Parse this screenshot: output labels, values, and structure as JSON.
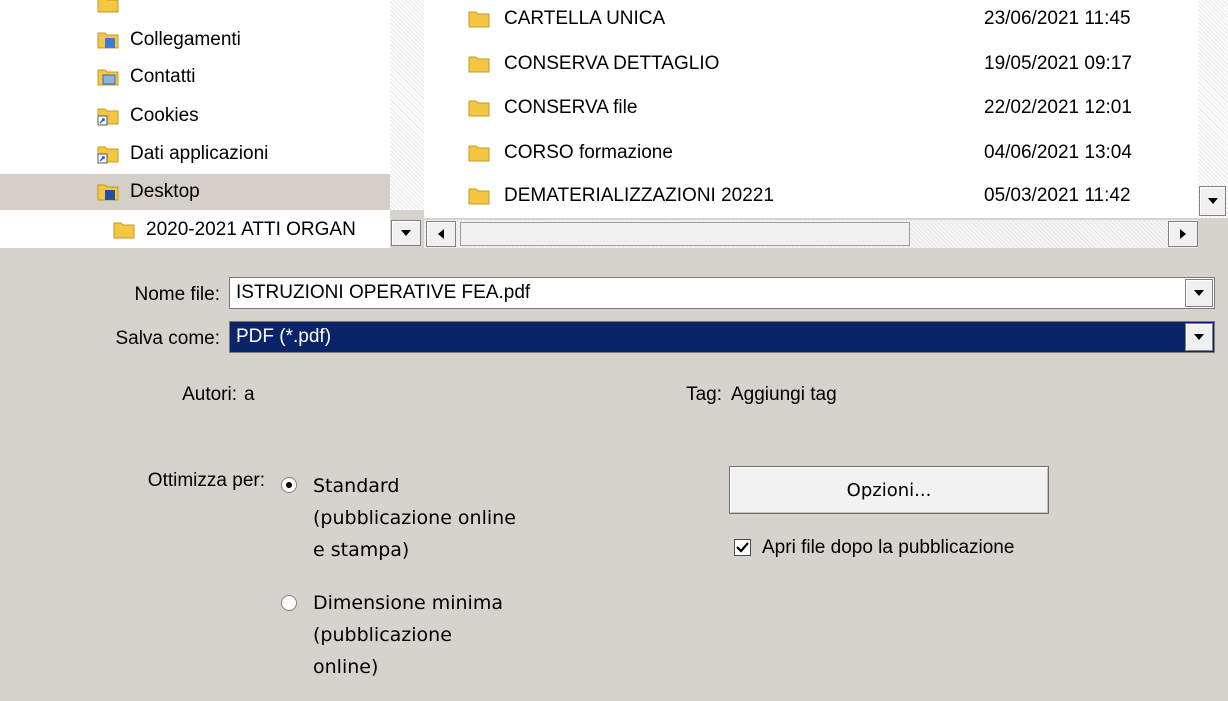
{
  "tree": {
    "items": [
      {
        "label": "Collegamenti",
        "icon": "blue-folder-icon",
        "selected": false
      },
      {
        "label": "Contatti",
        "icon": "contacts-folder-icon",
        "selected": false
      },
      {
        "label": "Cookies",
        "icon": "shortcut-folder-icon",
        "selected": false
      },
      {
        "label": "Dati applicazioni",
        "icon": "shortcut-folder-icon",
        "selected": false
      },
      {
        "label": "Desktop",
        "icon": "blue-folder-icon",
        "selected": true
      },
      {
        "label": "2020-2021 ATTI ORGAN",
        "icon": "folder-icon",
        "selected": false
      }
    ]
  },
  "files": [
    {
      "name": "CARTELLA UNICA",
      "date": "23/06/2021 11:45"
    },
    {
      "name": "CONSERVA DETTAGLIO",
      "date": "19/05/2021 09:17"
    },
    {
      "name": "CONSERVA file",
      "date": "22/02/2021 12:01"
    },
    {
      "name": "CORSO formazione",
      "date": "04/06/2021 13:04"
    },
    {
      "name": "DEMATERIALIZZAZIONI 20221",
      "date": "05/03/2021 11:42"
    }
  ],
  "form": {
    "filename_label": "Nome file:",
    "filename_value": "ISTRUZIONI OPERATIVE FEA.pdf",
    "saveas_label": "Salva come:",
    "saveas_value": "PDF (*.pdf)",
    "authors_label": "Autori:",
    "authors_value": "a",
    "tag_label": "Tag:",
    "tag_value": "Aggiungi tag"
  },
  "optimize": {
    "label": "Ottimizza per:",
    "options": [
      {
        "lines": [
          "Standard",
          "(pubblicazione online",
          "e stampa)"
        ],
        "selected": true
      },
      {
        "lines": [
          "Dimensione minima",
          "(pubblicazione",
          "online)"
        ],
        "selected": false
      }
    ]
  },
  "options_button": "Opzioni...",
  "open_after": {
    "label": "Apri file dopo la pubblicazione",
    "checked": true
  },
  "colors": {
    "selection": "#0a246a",
    "dialog_bg": "#d6d3ce",
    "folder": "#f3c744"
  }
}
